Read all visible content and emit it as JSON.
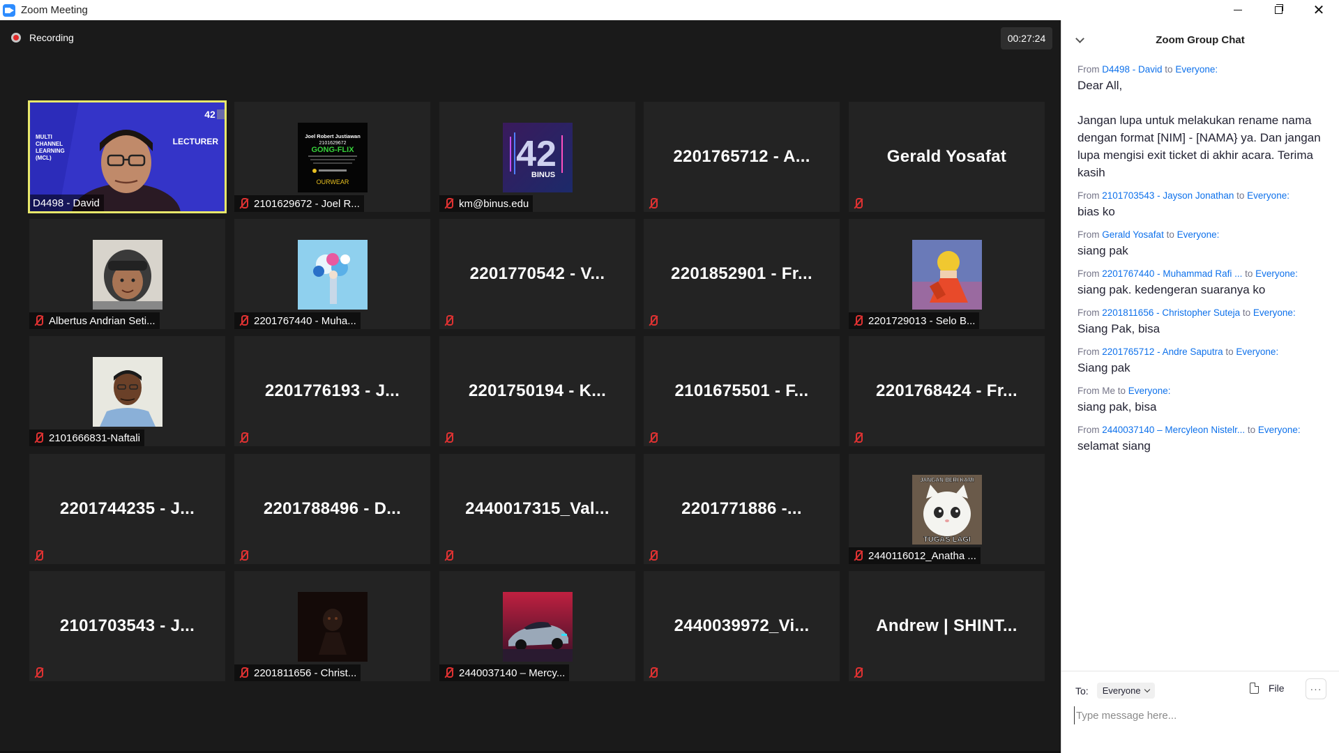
{
  "window": {
    "title": "Zoom Meeting",
    "minimize_label": "",
    "maximize_label": "",
    "close_label": "✕"
  },
  "meeting": {
    "recording_label": "Recording",
    "timer": "00:27:24"
  },
  "participants": [
    {
      "name": "D4498 - David",
      "big": "",
      "photo": "lecturer",
      "active": true
    },
    {
      "name": "2101629672 - Joel R...",
      "big": "",
      "photo": "gongflix"
    },
    {
      "name": "km@binus.edu",
      "big": "",
      "photo": "binus42"
    },
    {
      "name": "",
      "big": "2201765712 - A...",
      "photo": ""
    },
    {
      "name": "",
      "big": "Gerald Yosafat",
      "photo": ""
    },
    {
      "name": "Albertus Andrian Seti...",
      "big": "",
      "photo": "helmet"
    },
    {
      "name": "2201767440 - Muha...",
      "big": "",
      "photo": "flowers"
    },
    {
      "name": "",
      "big": "2201770542 - V...",
      "photo": ""
    },
    {
      "name": "",
      "big": "2201852901 - Fr...",
      "photo": ""
    },
    {
      "name": "2201729013 - Selo B...",
      "big": "",
      "photo": "anime"
    },
    {
      "name": "2101666831-Naftali",
      "big": "",
      "photo": "man"
    },
    {
      "name": "",
      "big": "2201776193 - J...",
      "photo": ""
    },
    {
      "name": "",
      "big": "2201750194 - K...",
      "photo": ""
    },
    {
      "name": "",
      "big": "2101675501 - F...",
      "photo": ""
    },
    {
      "name": "",
      "big": "2201768424 - Fr...",
      "photo": ""
    },
    {
      "name": "",
      "big": "2201744235 - J...",
      "photo": ""
    },
    {
      "name": "",
      "big": "2201788496 - D...",
      "photo": ""
    },
    {
      "name": "",
      "big": "2440017315_Val...",
      "photo": ""
    },
    {
      "name": "",
      "big": "2201771886 -...",
      "photo": ""
    },
    {
      "name": "2440116012_Anatha ...",
      "big": "",
      "photo": "cat"
    },
    {
      "name": "",
      "big": "2101703543 - J...",
      "photo": ""
    },
    {
      "name": "2201811656 - Christ...",
      "big": "",
      "photo": "dark"
    },
    {
      "name": "2440037140 – Mercy...",
      "big": "",
      "photo": "car"
    },
    {
      "name": "",
      "big": "2440039972_Vi...",
      "photo": ""
    },
    {
      "name": "",
      "big": "Andrew | SHINT...",
      "photo": ""
    }
  ],
  "photo_text": {
    "lecturer_label": "LECTURER",
    "lecturer_org": "MULTI CHANNEL LEARNING (MCL)",
    "gongflix_name": "Joel Robert Justiawan",
    "gongflix_id": "2101629672",
    "gongflix_brand": "GONG-FLIX",
    "gongflix_sub": "OURWEAR",
    "binus_text": "BINUS",
    "cat_top": "JANGAN BERI KAMI",
    "cat_bottom": "TUGAS LAGI"
  },
  "chat": {
    "title": "Zoom Group Chat",
    "messages": [
      {
        "from_prefix": "From ",
        "sender": "D4498 - David",
        "to_prefix": " to ",
        "recipient": "Everyone:",
        "text": "Dear All,\n\nJangan lupa untuk melakukan rename nama dengan format [NIM] - [NAMA} ya. Dan jangan lupa mengisi exit ticket di akhir acara. Terima kasih"
      },
      {
        "from_prefix": "From ",
        "sender": "2101703543 - Jayson Jonathan",
        "to_prefix": " to ",
        "recipient": "Everyone:",
        "text": "bias ko"
      },
      {
        "from_prefix": "From ",
        "sender": "Gerald Yosafat",
        "to_prefix": " to ",
        "recipient": "Everyone:",
        "text": "siang pak"
      },
      {
        "from_prefix": "From ",
        "sender": "2201767440 - Muhammad Rafi ...",
        "to_prefix": "  to ",
        "recipient": "Everyone:",
        "text": "siang pak. kedengeran suaranya ko"
      },
      {
        "from_prefix": "From ",
        "sender": "2201811656 - Christopher Suteja",
        "to_prefix": " to ",
        "recipient": "Everyone:",
        "text": "Siang Pak, bisa"
      },
      {
        "from_prefix": "From ",
        "sender": "2201765712 - Andre Saputra",
        "to_prefix": " to ",
        "recipient": "Everyone:",
        "text": "Siang pak"
      },
      {
        "from_prefix": "From Me",
        "sender": "",
        "to_prefix": " to ",
        "recipient": "Everyone:",
        "text": "siang pak, bisa"
      },
      {
        "from_prefix": "From ",
        "sender": "2440037140 – Mercyleon Nistelr...",
        "to_prefix": "  to ",
        "recipient": "Everyone:",
        "text": "selamat siang"
      }
    ],
    "to_label": "To:",
    "to_value": "Everyone",
    "file_label": "File",
    "more_label": "···",
    "input_placeholder": "Type message here..."
  },
  "colors": {
    "accent": "#0e71eb",
    "active_speaker_border": "#e8e86a",
    "muted_icon": "#e03232",
    "tile_bg": "#232323",
    "stage_bg": "#1a1a1a"
  }
}
